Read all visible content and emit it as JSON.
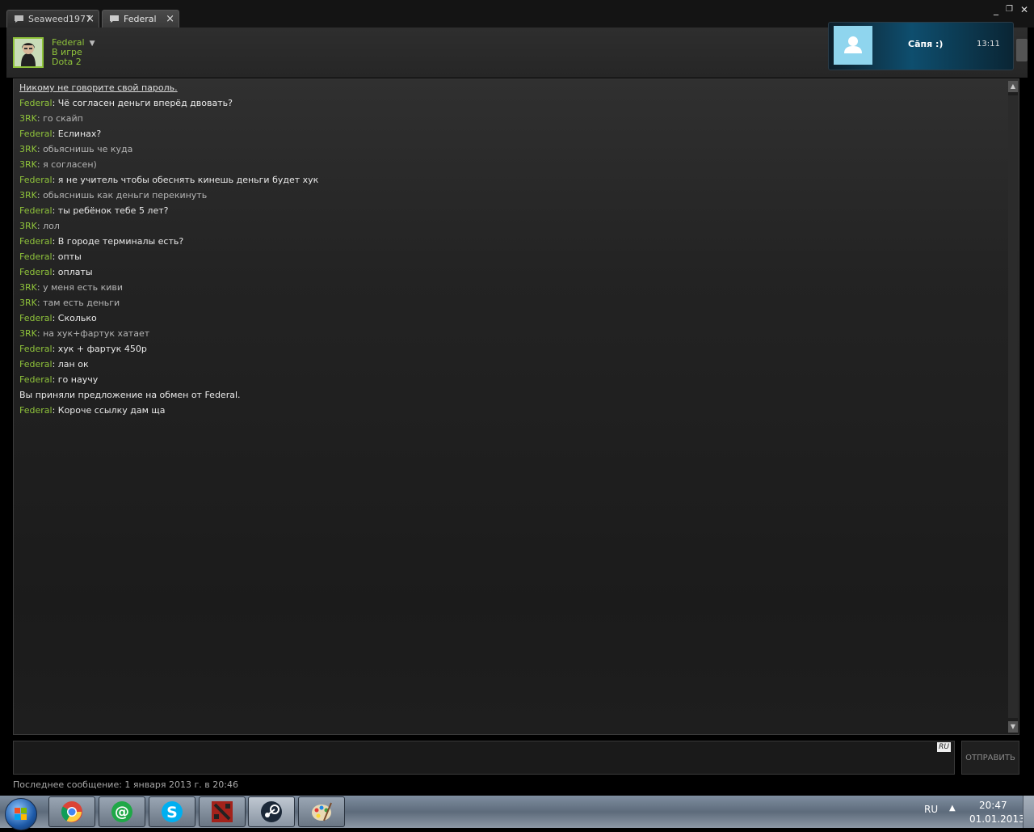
{
  "tabs": [
    {
      "label": "Seaweed1977",
      "active": false
    },
    {
      "label": "Federal",
      "active": true
    }
  ],
  "window_controls": {
    "minimize": "_",
    "maximize": "❐",
    "close": "✕"
  },
  "header": {
    "name": "Federal",
    "status": "В игре",
    "game": "Dota 2"
  },
  "chat": {
    "warning": "Никому не говорите свой пароль.",
    "messages": [
      {
        "sender": "Federal",
        "text": "Чё согласен деньги вперёд двовать?",
        "kind": "federal"
      },
      {
        "sender": "3RK",
        "text": "го скайп",
        "kind": "zrk"
      },
      {
        "sender": "Federal",
        "text": "Еслинах?",
        "kind": "federal"
      },
      {
        "sender": "3RK",
        "text": "обьяснишь че куда",
        "kind": "zrk"
      },
      {
        "sender": "3RK",
        "text": "я согласен)",
        "kind": "zrk"
      },
      {
        "sender": "Federal",
        "text": "я не учитель чтобы обеснять кинешь деньги будет хук",
        "kind": "federal"
      },
      {
        "sender": "3RK",
        "text": "обьяснишь как деньги перекинуть",
        "kind": "zrk"
      },
      {
        "sender": "Federal",
        "text": "ты ребёнок тебе 5 лет?",
        "kind": "federal"
      },
      {
        "sender": "3RK",
        "text": "лол",
        "kind": "zrk"
      },
      {
        "sender": "Federal",
        "text": "В городе терминалы есть?",
        "kind": "federal"
      },
      {
        "sender": "Federal",
        "text": "опты",
        "kind": "federal"
      },
      {
        "sender": "Federal",
        "text": "оплаты",
        "kind": "federal"
      },
      {
        "sender": "3RK",
        "text": "у меня есть киви",
        "kind": "zrk"
      },
      {
        "sender": "3RK",
        "text": "там есть деньги",
        "kind": "zrk"
      },
      {
        "sender": "Federal",
        "text": "Сколько",
        "kind": "federal"
      },
      {
        "sender": "3RK",
        "text": "на хук+фартук хатает",
        "kind": "zrk"
      },
      {
        "sender": "Federal",
        "text": "хук + фартук 450р",
        "kind": "federal"
      },
      {
        "sender": "Federal",
        "text": "лан ок",
        "kind": "federal"
      },
      {
        "sender": "Federal",
        "text": "го научу",
        "kind": "federal"
      },
      {
        "sender": "",
        "text": "Вы приняли предложение на обмен от Federal.",
        "kind": "system"
      },
      {
        "sender": "Federal",
        "text": "Короче ссылку дам ща",
        "kind": "federal"
      }
    ]
  },
  "input": {
    "lang_badge": "RU",
    "value": ""
  },
  "send_label": "ОТПРАВИТЬ",
  "last_message": "Последнее сообщение: 1 января 2013 г. в 20:46",
  "notification": {
    "name": "Сāпя :)",
    "time": "13:11"
  },
  "taskbar": {
    "apps": [
      "chrome-icon",
      "mail-agent-icon",
      "skype-icon",
      "dota2-icon",
      "steam-icon",
      "paint-icon"
    ],
    "lang": "RU",
    "time": "20:47",
    "date": "01.01.2013"
  },
  "colors": {
    "accent_green": "#8fc33b",
    "background": "#1e1e1e"
  }
}
